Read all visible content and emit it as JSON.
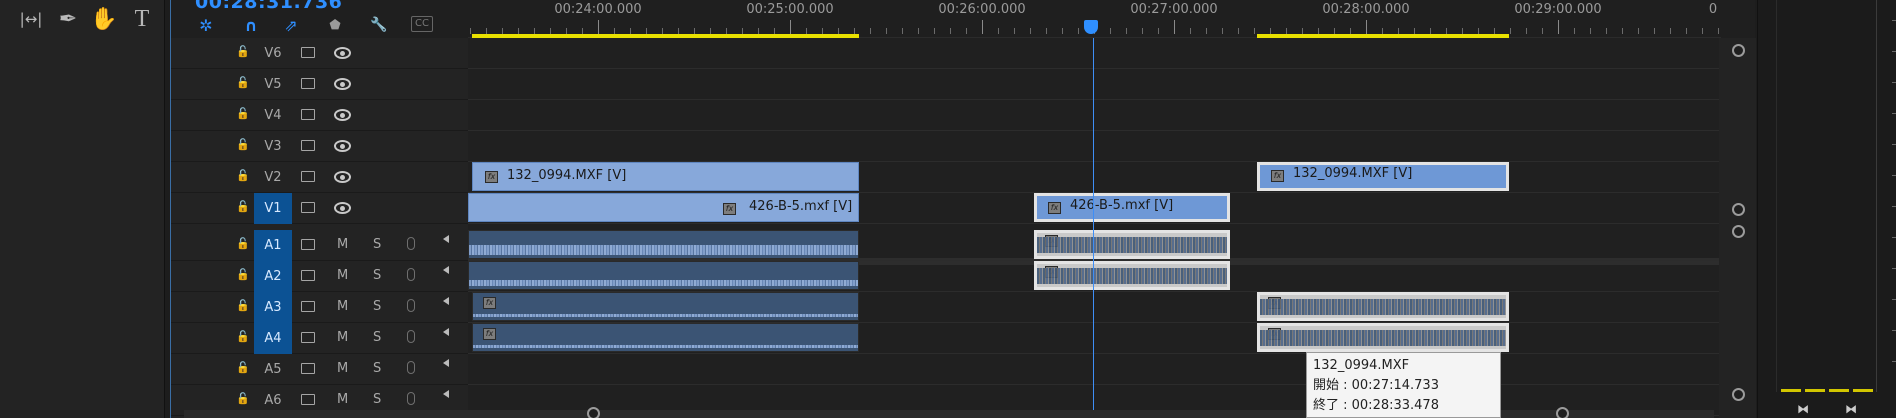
{
  "tools": {
    "items": [
      {
        "name": "slip-tool",
        "glyph": "|↔|"
      },
      {
        "name": "pen-tool",
        "glyph": "✒"
      },
      {
        "name": "hand-tool",
        "glyph": "✋"
      },
      {
        "name": "type-tool",
        "glyph": "T"
      }
    ]
  },
  "timeline": {
    "timecode": "00:28:31.736",
    "toolbar": {
      "nest_icon": "✲",
      "snap_icon": "∩",
      "linked_icon": "⇗",
      "marker_icon": "⬟",
      "wrench_icon": "🔧",
      "captions_label": "CC"
    },
    "ruler": {
      "labels": [
        "00:24:00.000",
        "00:25:00.000",
        "00:26:00.000",
        "00:27:00.000",
        "00:28:00.000",
        "00:29:00.000",
        "0"
      ]
    },
    "video_tracks": [
      "V6",
      "V5",
      "V4",
      "V3",
      "V2",
      "V1"
    ],
    "audio_tracks": [
      "A1",
      "A2",
      "A3",
      "A4",
      "A5",
      "A6"
    ],
    "audio_mute_label": "M",
    "audio_solo_label": "S",
    "clips": {
      "v2_left": "132_0994.MXF [V]",
      "v1_left": "426-B-5.mxf [V]",
      "v1_mid": "426-B-5.mxf [V]",
      "v2_right": "132_0994.MXF [V]",
      "fx_badge": "fx"
    },
    "tooltip": {
      "name": "132_0994.MXF",
      "start": "開始 : 00:27:14.733",
      "end": "終了 : 00:28:33.478"
    }
  },
  "meters": {
    "left_button_icon": "⧓",
    "right_button_icon": "⧓"
  }
}
